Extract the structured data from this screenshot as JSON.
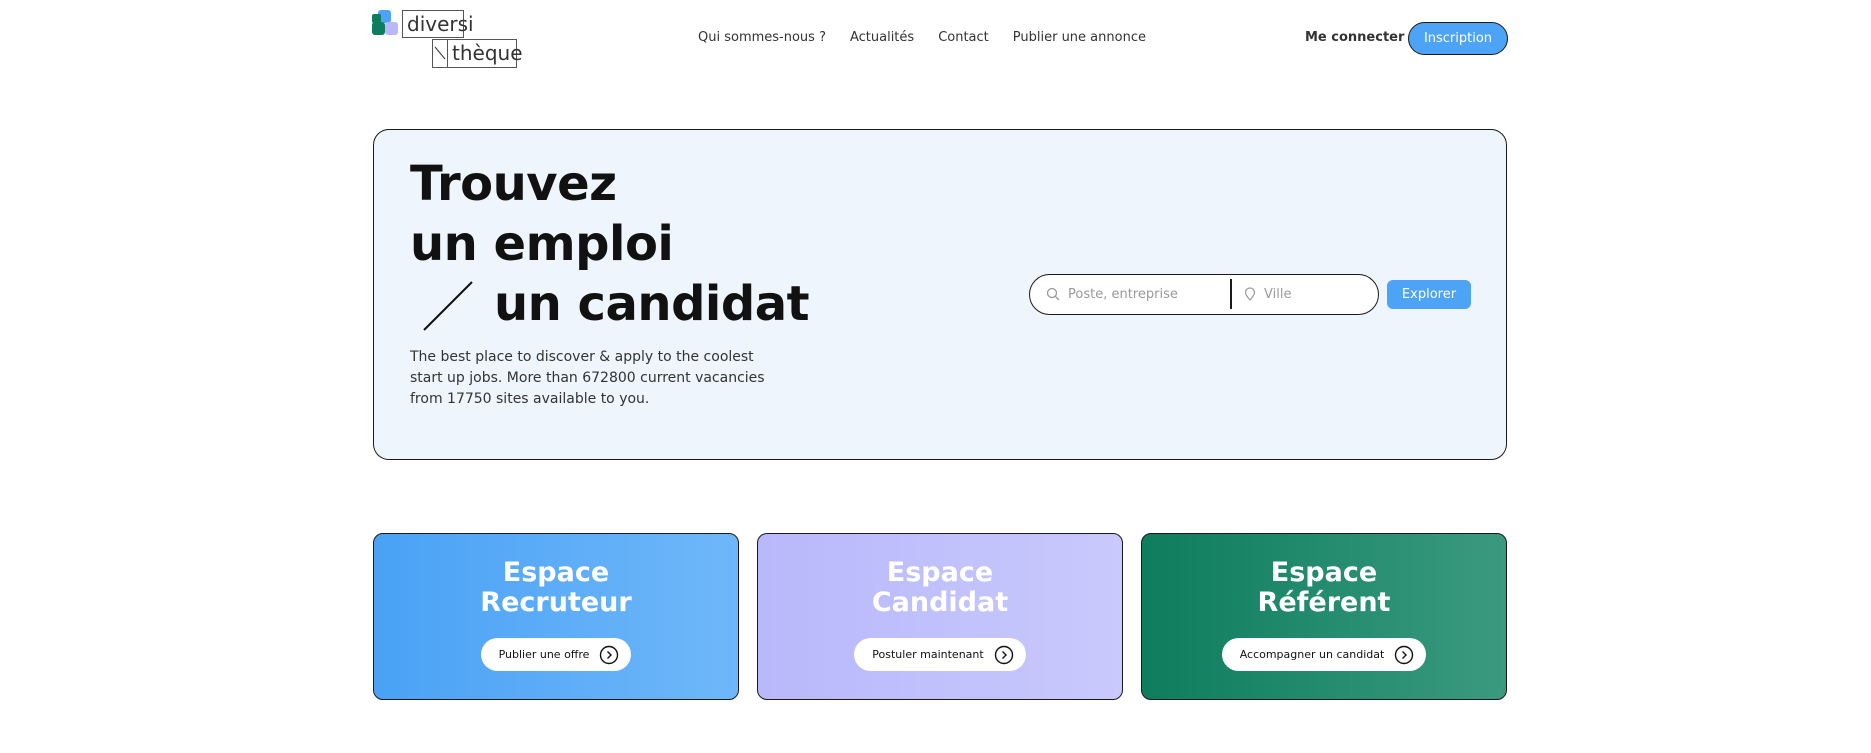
{
  "colors": {
    "accent": "#4da3f5",
    "hero_bg": "#eef5fd",
    "card_recruteur": "#4aa2f5",
    "card_candidat": "#b8b8fb",
    "card_referent": "#0e7d5d",
    "logo_blue": "#4da3f5",
    "logo_purple": "#b8b8fb",
    "logo_green": "#0e7d5d"
  },
  "logo": {
    "part1": "diversi",
    "part2": "thèque"
  },
  "nav": {
    "items": [
      {
        "label": "Qui sommes-nous ?"
      },
      {
        "label": "Actualités"
      },
      {
        "label": "Contact"
      },
      {
        "label": "Publier une annonce"
      }
    ]
  },
  "auth": {
    "login_label": "Me connecter",
    "signup_label": "Inscription"
  },
  "hero": {
    "title_line1": "Trouvez",
    "title_line2": "un emploi",
    "title_line3": "un candidat",
    "description": "The best place to discover & apply to the coolest start up jobs. More than 672800 current vacancies from 17750 sites available to you.",
    "search": {
      "job_placeholder": "Poste, entreprise",
      "city_placeholder": "Ville",
      "job_icon": "search-icon",
      "city_icon": "location-pin-icon",
      "submit_label": "Explorer"
    }
  },
  "cards": [
    {
      "title_line1": "Espace",
      "title_line2": "Recruteur",
      "button_label": "Publier une offre",
      "icon": "chevron-right-circle-icon"
    },
    {
      "title_line1": "Espace",
      "title_line2": "Candidat",
      "button_label": "Postuler maintenant",
      "icon": "chevron-right-circle-icon"
    },
    {
      "title_line1": "Espace",
      "title_line2": "Référent",
      "button_label": "Accompagner un candidat",
      "icon": "chevron-right-circle-icon"
    }
  ]
}
